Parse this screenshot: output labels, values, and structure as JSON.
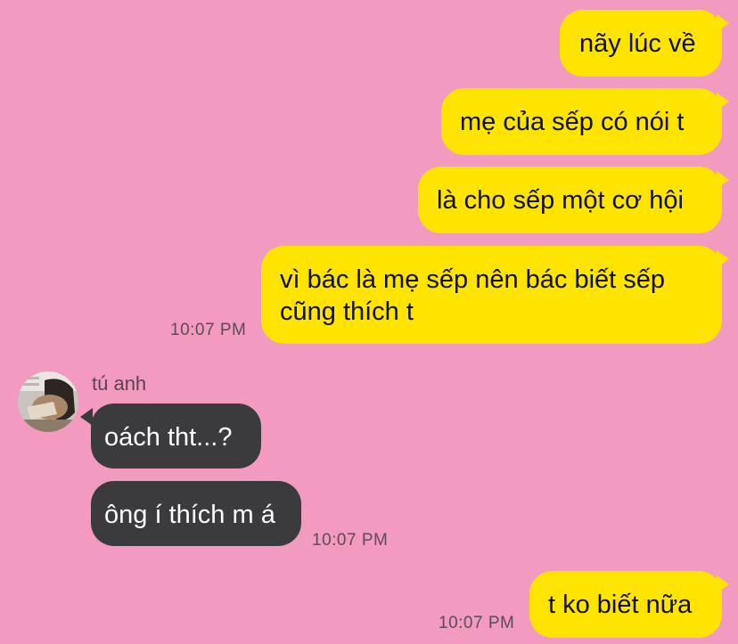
{
  "conversation": {
    "messages": [
      {
        "direction": "outgoing",
        "text": "nãy lúc về"
      },
      {
        "direction": "outgoing",
        "text": "mẹ của sếp có nói t"
      },
      {
        "direction": "outgoing",
        "text": "là cho sếp một cơ hội"
      },
      {
        "direction": "outgoing",
        "text": "vì bác là mẹ sếp nên bác biết sếp cũng thích t",
        "time": "10:07 PM"
      },
      {
        "direction": "incoming",
        "sender": "tú anh",
        "text": "oách tht...?"
      },
      {
        "direction": "incoming",
        "text": "ông í thích m á",
        "time": "10:07 PM"
      },
      {
        "direction": "outgoing",
        "text": "t ko biết nữa",
        "time": "10:07 PM"
      }
    ]
  },
  "msg1": {
    "text": "nãy lúc về"
  },
  "msg2": {
    "text": "mẹ của sếp có nói t"
  },
  "msg3": {
    "text": "là cho sếp một cơ hội"
  },
  "msg4": {
    "line1": "vì bác là mẹ sếp nên bác biết sếp",
    "line2": "cũng thích t",
    "time": "10:07 PM"
  },
  "msg5": {
    "sender": "tú anh",
    "text": "oách tht...?"
  },
  "msg6": {
    "text": "ông í thích m á",
    "time": "10:07 PM"
  },
  "msg7": {
    "text": "t ko biết nữa",
    "time": "10:07 PM"
  },
  "colors": {
    "background": "#f39ac1",
    "outgoing_bubble": "#ffe400",
    "incoming_bubble": "#3b3a3c"
  },
  "icons": {
    "avatar": "contact-avatar-photo"
  }
}
